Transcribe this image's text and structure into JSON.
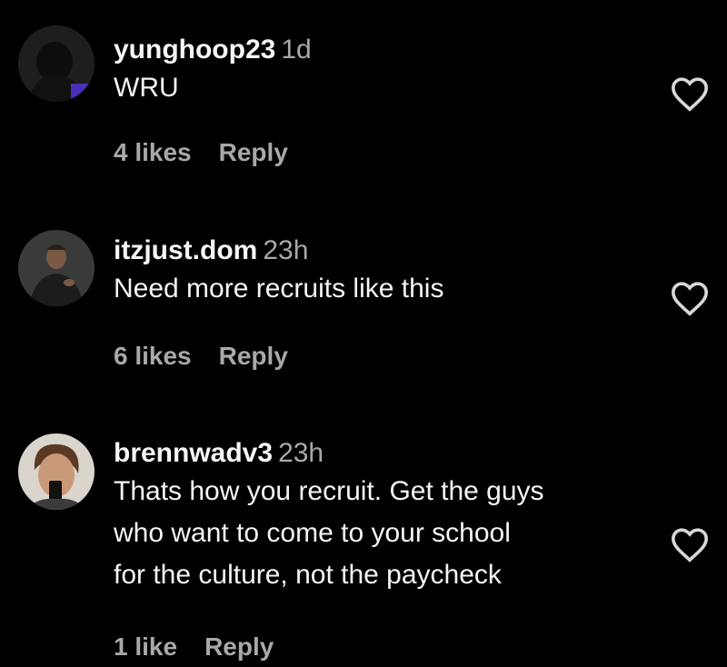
{
  "comments": [
    {
      "username": "yunghoop23",
      "time": "1d",
      "text": "WRU",
      "likes": "4 likes",
      "reply": "Reply",
      "icon": "heart-outline-icon"
    },
    {
      "username": "itzjust.dom",
      "time": "23h",
      "text": "Need more recruits like this",
      "likes": "6 likes",
      "reply": "Reply",
      "icon": "heart-outline-icon"
    },
    {
      "username": "brennwadv3",
      "time": "23h",
      "text": "Thats how you recruit. Get the guys\nwho want to come to your school\nfor the culture, not the paycheck",
      "likes": "1 like",
      "reply": "Reply",
      "icon": "heart-outline-icon"
    }
  ]
}
